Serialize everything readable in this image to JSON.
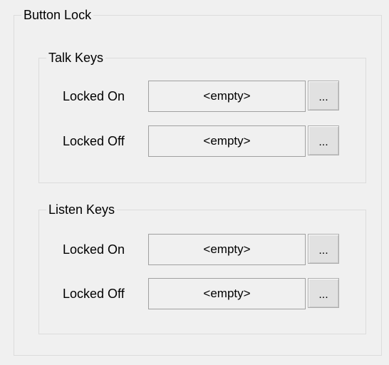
{
  "button_lock": {
    "title": "Button Lock",
    "talk_keys": {
      "title": "Talk Keys",
      "locked_on": {
        "label": "Locked On",
        "value": "<empty>",
        "button": "..."
      },
      "locked_off": {
        "label": "Locked Off",
        "value": "<empty>",
        "button": "..."
      }
    },
    "listen_keys": {
      "title": "Listen Keys",
      "locked_on": {
        "label": "Locked On",
        "value": "<empty>",
        "button": "..."
      },
      "locked_off": {
        "label": "Locked Off",
        "value": "<empty>",
        "button": "..."
      }
    }
  }
}
